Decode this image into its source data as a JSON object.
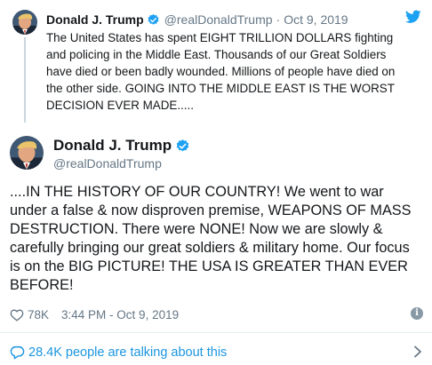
{
  "parent_tweet": {
    "author_name": "Donald J. Trump",
    "handle": "@realDonaldTrump",
    "separator": "·",
    "date": "Oct 9, 2019",
    "lines": [
      "The United States has spent EIGHT TRILLION DOLLARS fighting",
      "and policing in the Middle East. Thousands of our Great Soldiers",
      "have died or been badly wounded. Millions of people have died on",
      "the other side. GOING INTO THE MIDDLE EAST IS THE WORST",
      "DECISION EVER MADE....."
    ]
  },
  "main_tweet": {
    "author_name": "Donald J. Trump",
    "handle": "@realDonaldTrump",
    "lines": [
      "....IN THE HISTORY OF OUR COUNTRY! We went to war",
      "under a false & now disproven premise, WEAPONS OF MASS",
      "DESTRUCTION. There were NONE! Now we are slowly &",
      "carefully bringing our great soldiers & military home. Our focus",
      "is on the BIG PICTURE! THE USA IS GREATER THAN EVER",
      "BEFORE!"
    ],
    "likes": "78K",
    "timestamp": "3:44 PM - Oct 9, 2019"
  },
  "footer": {
    "talking_about": "28.4K people are talking about this"
  },
  "icons": {
    "verified": "verified-badge-icon",
    "twitter_bird": "twitter-bird-icon",
    "heart": "heart-icon",
    "info": "info-icon",
    "comment_bubble": "comment-bubble-icon",
    "chevron": "chevron-right-icon"
  },
  "colors": {
    "accent": "#1da1f2",
    "link": "#1b95e0",
    "muted": "#657786",
    "text": "#14171a",
    "line": "#ccd6dd"
  }
}
